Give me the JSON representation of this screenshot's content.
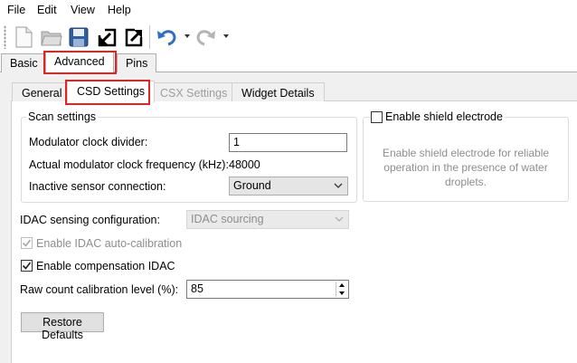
{
  "menu": {
    "file": "File",
    "edit": "Edit",
    "view": "View",
    "help": "Help"
  },
  "top_tabs": {
    "basic": "Basic",
    "advanced": "Advanced",
    "pins": "Pins"
  },
  "inner_tabs": {
    "general": "General",
    "csd": "CSD Settings",
    "csx": "CSX Settings",
    "widget": "Widget Details"
  },
  "scan": {
    "legend": "Scan settings",
    "mod_clk_label": "Modulator clock divider:",
    "mod_clk_value": "1",
    "actual_freq_label": "Actual modulator clock frequency (kHz):",
    "actual_freq_value": "48000",
    "inactive_label": "Inactive sensor connection:",
    "inactive_value": "Ground"
  },
  "shield": {
    "label": "Enable shield electrode",
    "checked": false,
    "description": "Enable shield electrode for reliable operation in the presence of water droplets."
  },
  "idac": {
    "config_label": "IDAC sensing configuration:",
    "config_value": "IDAC sourcing",
    "auto_cal_label": "Enable IDAC auto-calibration",
    "auto_cal_checked": true,
    "comp_label": "Enable compensation IDAC",
    "comp_checked": true
  },
  "raw_count": {
    "label": "Raw count calibration level (%):",
    "value": "85"
  },
  "restore_defaults": "Restore Defaults",
  "colors": {
    "highlight": "#e02424",
    "save_blue": "#2f5f9e",
    "undo_blue": "#2d6fc7"
  }
}
